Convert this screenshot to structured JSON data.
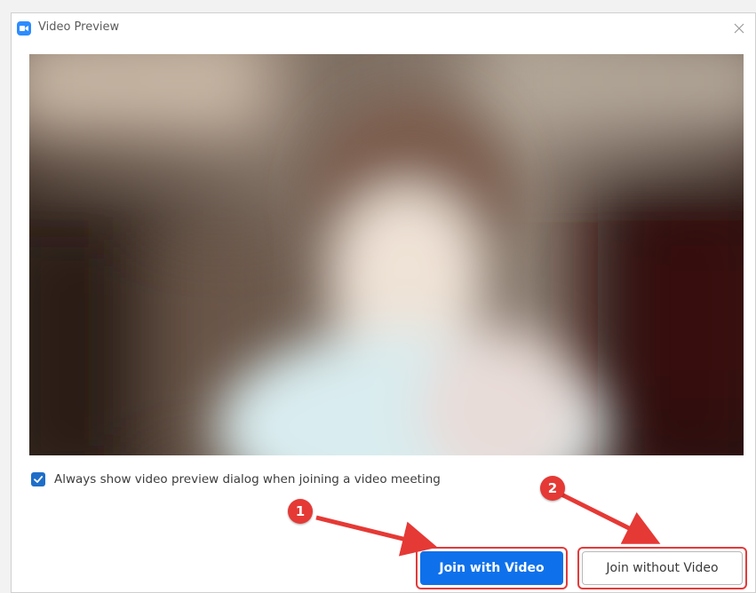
{
  "window": {
    "title": "Video Preview",
    "app_icon": "zoom-camera-icon",
    "close_icon": "close-icon"
  },
  "preview": {
    "content": "blurred-camera-feed"
  },
  "option": {
    "checked": true,
    "label": "Always show video preview dialog when joining a video meeting"
  },
  "buttons": {
    "join_with_video": "Join with Video",
    "join_without_video": "Join without Video"
  },
  "annotations": {
    "step_1": "1",
    "step_2": "2"
  },
  "colors": {
    "primary_button": "#0e71eb",
    "highlight_border": "#e23b3b",
    "annotation": "#e53935",
    "checkbox": "#1e6ec8",
    "app_icon": "#2d8cff"
  }
}
